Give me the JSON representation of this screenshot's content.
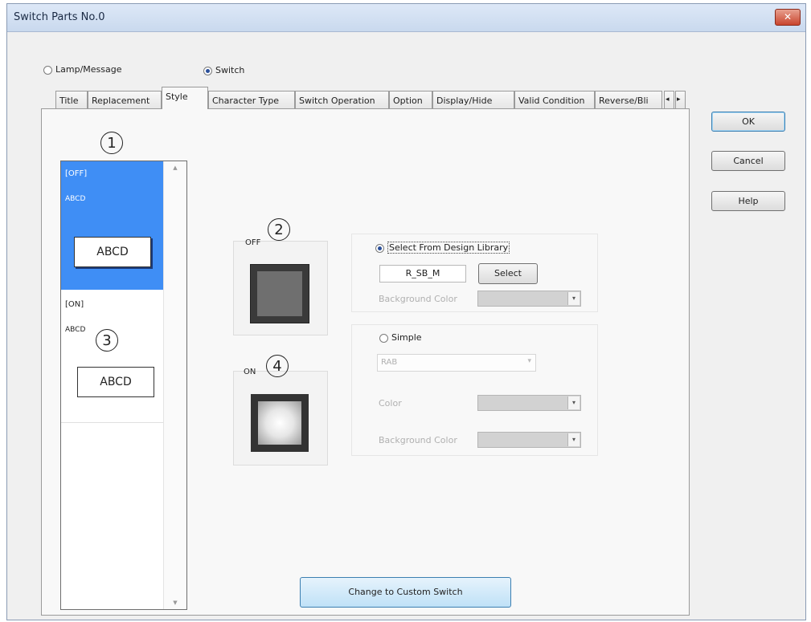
{
  "window": {
    "title": "Switch Parts No.0",
    "close_label": "✕"
  },
  "mode": {
    "lamp_label": "Lamp/Message",
    "switch_label": "Switch",
    "selected": "Switch"
  },
  "tabs": [
    "Title",
    "Replacement",
    "Style",
    "Character Type",
    "Switch Operation",
    "Option",
    "Display/Hide",
    "Valid Condition",
    "Reverse/Bli"
  ],
  "active_tab": "Style",
  "tab_scroll": {
    "left": "◂",
    "right": "▸"
  },
  "buttons": {
    "ok": "OK",
    "cancel": "Cancel",
    "help": "Help",
    "custom": "Change to Custom Switch",
    "select": "Select"
  },
  "callouts": {
    "c1": "1",
    "c2": "2",
    "c3": "3",
    "c4": "4"
  },
  "style_list": {
    "off": {
      "label": "[OFF]",
      "text": "ABCD",
      "button_text": "ABCD"
    },
    "on": {
      "label": "[ON]",
      "text": "ABCD",
      "button_text": "ABCD"
    }
  },
  "preview": {
    "off_label": "OFF",
    "on_label": "ON"
  },
  "design_library": {
    "radio_label": "Select From Design Library",
    "selected": true,
    "value": "R_SB_M",
    "bg_color_label": "Background Color"
  },
  "simple": {
    "radio_label": "Simple",
    "shape": "RAB",
    "color_label": "Color",
    "bg_color_label": "Background Color"
  },
  "colors": {
    "list_selected_bg": "#3f8ef5",
    "off_preview": "#6f6f6f",
    "on_preview_center": "#ffffff"
  }
}
